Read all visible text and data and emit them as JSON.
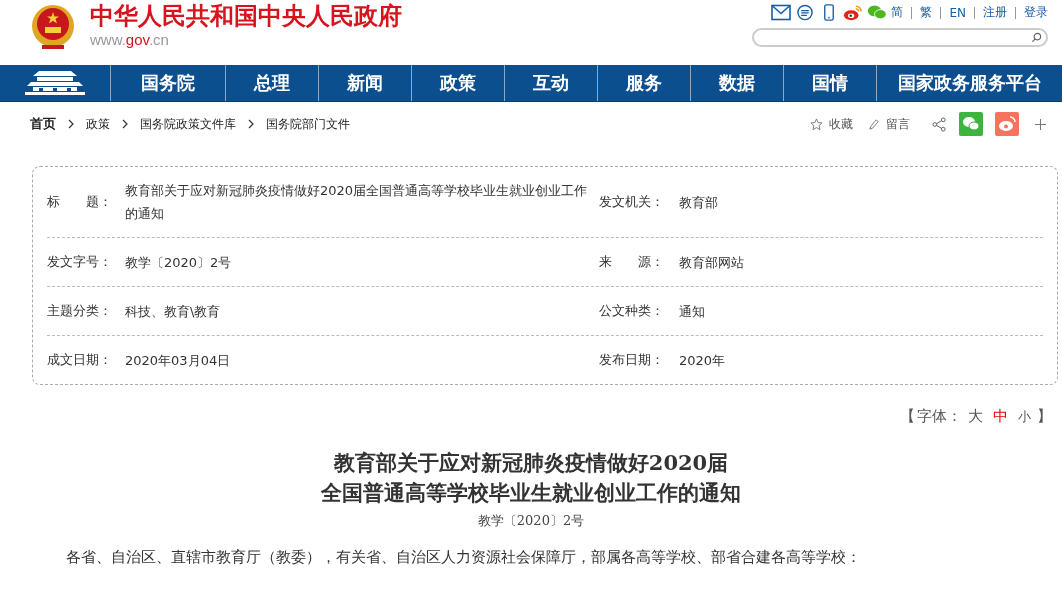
{
  "header": {
    "site_title": "中华人民共和国中央人民政府",
    "domain_prefix": "www.",
    "domain_mid": "gov",
    "domain_suffix": ".cn",
    "language_links": [
      "简",
      "繁",
      "EN"
    ],
    "account_links": [
      "注册",
      "登录"
    ]
  },
  "nav": [
    "国务院",
    "总理",
    "新闻",
    "政策",
    "互动",
    "服务",
    "数据",
    "国情",
    "国家政务服务平台"
  ],
  "breadcrumb": [
    "首页",
    "政策",
    "国务院政策文件库",
    "国务院部门文件"
  ],
  "actions": {
    "favorite": "收藏",
    "comment": "留言"
  },
  "info": [
    {
      "label": "标　　题：",
      "value": "教育部关于应对新冠肺炎疫情做好2020届全国普通高等学校毕业生就业创业工作的通知",
      "label2": "发文机关：",
      "value2": "教育部"
    },
    {
      "label": "发文字号：",
      "value": "教学〔2020〕2号",
      "label2": "来　　源：",
      "value2": "教育部网站"
    },
    {
      "label": "主题分类：",
      "value": "科技、教育\\教育",
      "label2": "公文种类：",
      "value2": "通知"
    },
    {
      "label": "成文日期：",
      "value": "2020年03月04日",
      "label2": "发布日期：",
      "value2": "2020年"
    }
  ],
  "font_size": {
    "open": "【",
    "label": "字体：",
    "close": "】",
    "options": [
      {
        "label": "大",
        "selected": false
      },
      {
        "label": "中",
        "selected": true
      },
      {
        "label": "小",
        "selected": false
      }
    ]
  },
  "article": {
    "title_lines": [
      "教育部关于应对新冠肺炎疫情做好2020届",
      "全国普通高等学校毕业生就业创业工作的通知"
    ],
    "doc_number": "教学〔2020〕2号",
    "paragraph": "各省、自治区、直辖市教育厅（教委），有关省、自治区人力资源社会保障厅，部属各高等学校、部省合建各高等学校："
  }
}
